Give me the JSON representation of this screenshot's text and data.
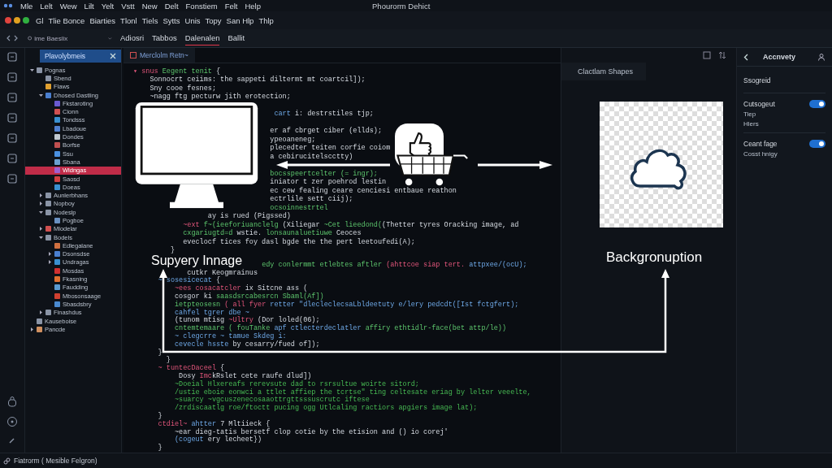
{
  "menu": [
    "Mle",
    "Lelt",
    "Wew",
    "Lilt",
    "Yelt",
    "Vstt",
    "New",
    "Delt",
    "Fonstiem",
    "Felt",
    "Help"
  ],
  "window": {
    "title": "Phourorm Dehict"
  },
  "toolbar": [
    "Gl",
    "Tlie Bonce",
    "Biarties",
    "Tlonl",
    "Tiels",
    "Sytts",
    "Unis",
    "Topy",
    "San Hlp",
    "Thlp"
  ],
  "sidebar": {
    "search": {
      "placeholder": "ime Baeslix"
    },
    "title": "Plavolybmeis",
    "tree": [
      {
        "label": "Pognas",
        "selected": false,
        "expanded": true,
        "color": "#8a94a6",
        "children": [
          {
            "label": "Sbend",
            "selected": false,
            "color": "#8a94a6"
          },
          {
            "label": "Flaws",
            "selected": false,
            "color": "#e0a030"
          },
          {
            "label": "Dhosed Dastling",
            "selected": false,
            "expanded": true,
            "color": "#4a7fd0",
            "children": [
              {
                "label": "Fkstaroting",
                "selected": false,
                "color": "#6a5ad0"
              },
              {
                "label": "Cionn",
                "selected": false,
                "color": "#d05050"
              },
              {
                "label": "Tondsss",
                "selected": false,
                "color": "#3a90d0"
              },
              {
                "label": "Lbadoue",
                "selected": false,
                "color": "#5080d0"
              },
              {
                "label": "Dondes",
                "selected": false,
                "color": "#c0c8d0"
              },
              {
                "label": "Borfse",
                "selected": false,
                "color": "#c05050"
              },
              {
                "label": "Ssu",
                "selected": false,
                "color": "#4a90e0"
              },
              {
                "label": "Sbana",
                "selected": false,
                "color": "#6aa0d0"
              },
              {
                "label": "Wldngas",
                "selected": true,
                "color": "#a060d0"
              },
              {
                "label": "Saosd",
                "selected": false,
                "color": "#d04040"
              },
              {
                "label": "Doeas",
                "selected": false,
                "color": "#3a90d0"
              }
            ]
          },
          {
            "label": "Aunlerbhans",
            "selected": false,
            "expanded": false,
            "color": "#8a94a6"
          },
          {
            "label": "Nopboy",
            "selected": false,
            "expanded": false,
            "color": "#8a94a6"
          },
          {
            "label": "Nodeslp",
            "selected": false,
            "expanded": true,
            "color": "#8a94a6",
            "children": [
              {
                "label": "Pogboe",
                "selected": false,
                "color": "#6a90c0"
              }
            ]
          },
          {
            "label": "Mlodelar",
            "selected": false,
            "expanded": false,
            "color": "#d05050"
          },
          {
            "label": "Bodels",
            "selected": false,
            "expanded": true,
            "color": "#8a94a6",
            "children": [
              {
                "label": "Edlegalane",
                "selected": false,
                "color": "#d07040"
              },
              {
                "label": "Dsonsdse",
                "selected": false,
                "expanded": false,
                "color": "#4a80d0"
              },
              {
                "label": "Undragas",
                "selected": false,
                "expanded": false,
                "color": "#3a90d0"
              },
              {
                "label": "Mosdas",
                "selected": false,
                "color": "#d03030"
              },
              {
                "label": "Fkasning",
                "selected": false,
                "color": "#e07030"
              },
              {
                "label": "Faudding",
                "selected": false,
                "color": "#5a9ad0"
              },
              {
                "label": "Mbosonsaage",
                "selected": false,
                "color": "#d04030"
              },
              {
                "label": "Sbasdsbry",
                "selected": false,
                "color": "#4a8ad0"
              }
            ]
          },
          {
            "label": "Finashdus",
            "selected": false,
            "expanded": false,
            "color": "#8a94a6"
          }
        ]
      },
      {
        "label": "Kauseboise",
        "selected": false,
        "color": "#8a94a6"
      },
      {
        "label": "Pancde",
        "selected": false,
        "expanded": false,
        "color": "#d09060"
      }
    ]
  },
  "tabs": [
    {
      "label": "Adiosri",
      "selected": false
    },
    {
      "label": "Tabbos",
      "selected": false
    },
    {
      "label": "Dalenalen",
      "selected": true
    },
    {
      "label": "Ballit",
      "selected": false
    }
  ],
  "editor": {
    "tab": "Merclolm Retn~",
    "lines": [
      [
        {
          "kind": "kw",
          "text": "▾ snus "
        },
        {
          "kind": "fn",
          "text": "Eegent tenit "
        },
        {
          "kind": "txt",
          "text": "{"
        }
      ],
      [
        {
          "kind": "txt",
          "text": "    Sonnocrt ceiims: the sappeti diltermt mt coartcil]);"
        }
      ],
      [
        {
          "kind": "txt",
          "text": "    Sny cooe fesnes;"
        }
      ],
      [
        {
          "kind": "txt",
          "text": "    ~nagg ftg pecturw jith erotection;"
        }
      ],
      [
        {
          "kind": "str",
          "text": "                                  cart "
        },
        {
          "kind": "txt",
          "text": "i: destrstiles tjp;"
        }
      ],
      [
        {
          "kind": "txt",
          "text": "                                 er af cbrget ciber (ellds);"
        }
      ],
      [
        {
          "kind": "txt",
          "text": "                                 ypeoaneneg;"
        }
      ],
      [
        {
          "kind": "txt",
          "text": "                                 plecedter teiten corfie coiom"
        }
      ],
      [
        {
          "kind": "txt",
          "text": "                                 a cebirucitelscctty)"
        }
      ],
      [
        {
          "kind": "fn",
          "text": "                                 bocsspeertcelter (= ingr);"
        }
      ],
      [
        {
          "kind": "txt",
          "text": "                                 iniator t zer poehrod lestin"
        }
      ],
      [
        {
          "kind": "txt",
          "text": "                                 ec cew fealing ceare cenciesi entbaue reathon"
        }
      ],
      [
        {
          "kind": "txt",
          "text": "                                 ectrlile sett ciij);"
        }
      ],
      [
        {
          "kind": "fn",
          "text": "                                 ocsoinnestrtel"
        }
      ],
      [
        {
          "kind": "txt",
          "text": "                  ay is rued (Pigssed)"
        }
      ],
      [
        {
          "kind": "kw",
          "text": "            ~ext "
        },
        {
          "kind": "fn",
          "text": "f~(ieeforiuanclelg "
        },
        {
          "kind": "txt",
          "text": "(Xiliegar "
        },
        {
          "kind": "fn",
          "text": "~Cet lieedond("
        },
        {
          "kind": "txt",
          "text": "(Thetter tyres Oracking image, ad"
        }
      ],
      [
        {
          "kind": "fn",
          "text": "            cxgariugtd=d "
        },
        {
          "kind": "txt",
          "text": "wstie. "
        },
        {
          "kind": "fn",
          "text": "lonsaunaluetiuwe "
        },
        {
          "kind": "txt",
          "text": "Ceoces"
        }
      ],
      [
        {
          "kind": "txt",
          "text": "            eveclocf tices foy dasl bgde the the pert leetoufedi(A);"
        }
      ],
      [
        {
          "kind": "txt",
          "text": "         }"
        }
      ],
      [
        {
          "kind": "fn",
          "text": "                               edy conlermmt etlebtes aftler "
        },
        {
          "kind": "kw",
          "text": "(ahttcoe siap tert. "
        },
        {
          "kind": "str",
          "text": "attpxee/(ocU);"
        }
      ],
      [
        {
          "kind": "txt",
          "text": "             cutkr Keogmrainus"
        }
      ],
      [
        {
          "kind": "str",
          "text": "      ~ sosesicecat "
        },
        {
          "kind": "txt",
          "text": "{"
        }
      ],
      [
        {
          "kind": "kw",
          "text": "          ~ees cosacatcler "
        },
        {
          "kind": "txt",
          "text": "ix Sitcne ass ("
        }
      ],
      [
        {
          "kind": "txt",
          "text": "          cosgor ki "
        },
        {
          "kind": "fn",
          "text": "saasdsrcabesrcn Sbaml(Af])"
        }
      ],
      [
        {
          "kind": "fn",
          "text": "          ietpteosesn "
        },
        {
          "kind": "kw",
          "text": "( all fyer "
        },
        {
          "kind": "str",
          "text": "retter \"dlecleclecsaLbldeetuty e/lery pedcdt([Ist fctgfert);"
        }
      ],
      [
        {
          "kind": "str",
          "text": "          cahfel tgrer dbe ~"
        }
      ],
      [
        {
          "kind": "txt",
          "text": "          (tunom mtisg "
        },
        {
          "kind": "kw",
          "text": "~Ultry "
        },
        {
          "kind": "txt",
          "text": "(Dor loled(06);"
        }
      ],
      [
        {
          "kind": "fn",
          "text": "          cntemtemaare ( fouTanke "
        },
        {
          "kind": "str",
          "text": "apf ctlecterdeclatler "
        },
        {
          "kind": "fn",
          "text": "affiry ethtidlr-face(bet attp/le))"
        }
      ],
      [
        {
          "kind": "str",
          "text": "          ~ clegcrre ~ tamue Skdeg i:"
        }
      ],
      [
        {
          "kind": "str",
          "text": "          cevecle hsste "
        },
        {
          "kind": "txt",
          "text": "by cesarry/fued of]);"
        }
      ],
      [
        {
          "kind": "txt",
          "text": "      }"
        }
      ],
      [
        {
          "kind": "txt",
          "text": "        }"
        }
      ],
      [
        {
          "kind": "kw",
          "text": "      ~ tuntecDaceel "
        },
        {
          "kind": "txt",
          "text": "{"
        }
      ],
      [
        {
          "kind": "txt",
          "text": "           Dosy "
        },
        {
          "kind": "kw",
          "text": "Imc"
        },
        {
          "kind": "txt",
          "text": "kRslet cete raufe dlud])"
        }
      ],
      [
        {
          "kind": "cm",
          "text": "          ~Doeial Hlxereafs rerevsute dad to rsrsultue woirte sitord;"
        }
      ],
      [
        {
          "kind": "cm",
          "text": "          /ustie eboie eonwci a ttlet affiep the tcrtse\" ting celtesate eriag by lelter veeelte,"
        }
      ],
      [
        {
          "kind": "cm",
          "text": "          ~suarcy ~vgcuszenecosaaottrgttsssuscrutc iftese"
        }
      ],
      [
        {
          "kind": "cm",
          "text": "          /zrdiscaatlg roe/ftoctt pucing ogg Utlcaling ractiors apgiers image lat);"
        }
      ],
      [
        {
          "kind": "txt",
          "text": "      }"
        }
      ],
      [
        {
          "kind": "kw",
          "text": "      ctdiel~ "
        },
        {
          "kind": "str",
          "text": "ahtter "
        },
        {
          "kind": "txt",
          "text": "7 Mltiieck {"
        }
      ],
      [
        {
          "kind": "txt",
          "text": "          ~ear dieg-tatis bersetf clop cotie by the etision and () io corej'"
        }
      ],
      [
        {
          "kind": "str",
          "text": "          (cogeut "
        },
        {
          "kind": "txt",
          "text": "ery lecheet})"
        }
      ],
      [
        {
          "kind": "txt",
          "text": "      }"
        }
      ]
    ]
  },
  "preview": {
    "tab": "Clactlam Shapes"
  },
  "diagram": {
    "left_caption": "Supyery Innage",
    "right_caption": "Backgronuption"
  },
  "panel": {
    "title": "Accnvety",
    "heading": "Ssogreid",
    "settings": [
      {
        "label": "Cutsogeut",
        "on": true,
        "notes": [
          "Tiep",
          "Hlers"
        ]
      },
      {
        "label": "Ceant fage",
        "on": true,
        "notes": [
          "Cosst hnigy"
        ]
      }
    ]
  },
  "status_bar": "Fiatrorm ( Mesible Felgron)"
}
